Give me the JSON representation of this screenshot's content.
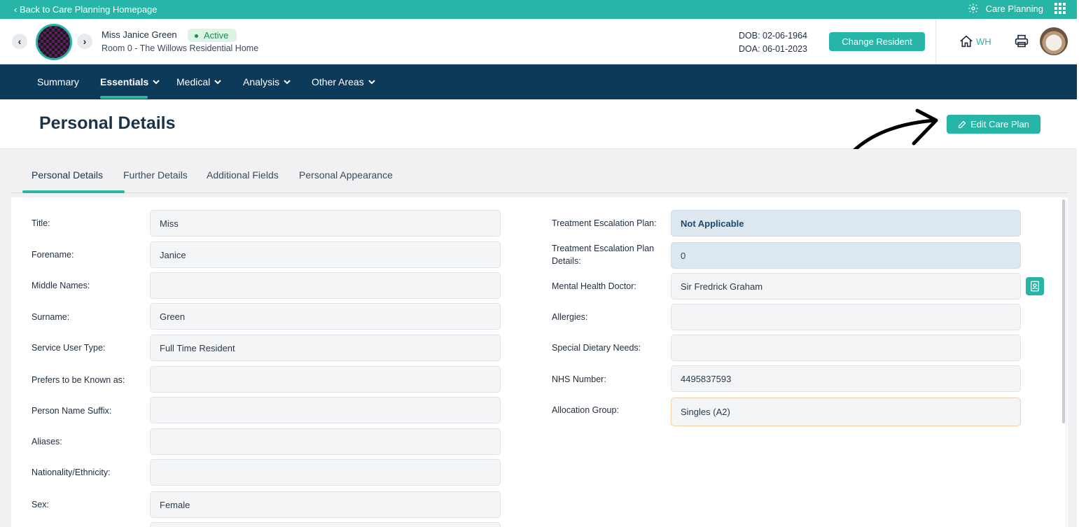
{
  "topbar": {
    "back_label": "‹ Back to Care Planning Homepage",
    "app_label": "Care Planning"
  },
  "resident": {
    "name": "Miss Janice Green",
    "status": "Active",
    "room": "Room 0 - The Willows Residential Home",
    "dob": "DOB: 02-06-1964",
    "doa": "DOA: 06-01-2023",
    "change_label": "Change Resident",
    "home_code": "WH"
  },
  "nav": {
    "items": [
      "Summary",
      "Essentials",
      "Medical",
      "Analysis",
      "Other Areas"
    ]
  },
  "page": {
    "title": "Personal Details",
    "edit_label": "Edit Care Plan"
  },
  "tabs": [
    "Personal Details",
    "Further Details",
    "Additional Fields",
    "Personal Appearance"
  ],
  "left_fields": [
    {
      "label": "Title:",
      "value": "Miss"
    },
    {
      "label": "Forename:",
      "value": "Janice"
    },
    {
      "label": "Middle Names:",
      "value": ""
    },
    {
      "label": "Surname:",
      "value": "Green"
    },
    {
      "label": "Service User Type:",
      "value": "Full Time Resident"
    },
    {
      "label": "Prefers to be Known as:",
      "value": ""
    },
    {
      "label": "Person Name Suffix:",
      "value": ""
    },
    {
      "label": "Aliases:",
      "value": ""
    },
    {
      "label": "Nationality/Ethnicity:",
      "value": ""
    },
    {
      "label": "Sex:",
      "value": "Female"
    }
  ],
  "right_fields": [
    {
      "label": "Treatment Escalation Plan:",
      "value": "Not Applicable"
    },
    {
      "label": "Treatment Escalation Plan Details:",
      "value": "0"
    },
    {
      "label": "Mental Health Doctor:",
      "value": "Sir Fredrick Graham"
    },
    {
      "label": "Allergies:",
      "value": ""
    },
    {
      "label": "Special Dietary Needs:",
      "value": ""
    },
    {
      "label": "NHS Number:",
      "value": "4495837593"
    },
    {
      "label": "Allocation Group:",
      "value": "Singles (A2)"
    }
  ],
  "colors": {
    "accent": "#26b5a6",
    "nav": "#0e3a5a",
    "active_badge": "#1e8a52"
  },
  "icons": [
    "gear-icon",
    "apps-grid-icon",
    "chevron-left-icon",
    "chevron-right-icon",
    "home-icon",
    "printer-icon",
    "pencil-icon",
    "contact-card-icon",
    "chevron-down-icon"
  ]
}
